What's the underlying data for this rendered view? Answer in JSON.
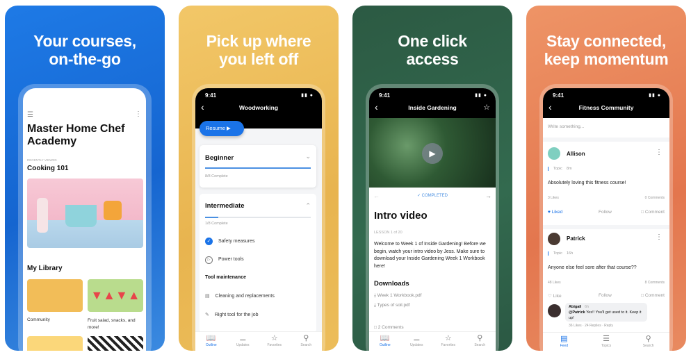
{
  "colors": {
    "blue_panel": "#1b72de",
    "yellow_panel": "#efbf5c",
    "green_panel": "#2f5f46",
    "orange_panel": "#e8845c",
    "accent": "#1a73e8"
  },
  "panels": [
    {
      "headline": [
        "Your courses,",
        "on-the-go"
      ],
      "screen": {
        "menu_icon": "hamburger-icon",
        "more_icon": "kebab-icon",
        "title": "Master Home Chef Academy",
        "recently_viewed_label": "RECENTLY VIEWED",
        "recent_course": "Cooking 101",
        "library_heading": "My Library",
        "library_items": [
          "Community",
          "Fruit salad, snacks, and more!"
        ]
      }
    },
    {
      "headline": [
        "Pick up where",
        "you left off"
      ],
      "screen": {
        "time": "9:41",
        "title": "Woodworking",
        "resume_label": "Resume",
        "sections": [
          {
            "title": "Beginner",
            "progress_text": "8/8 Complete",
            "progress": 1.0,
            "expanded": false
          },
          {
            "title": "Intermediate",
            "progress_text": "1/8 Complete",
            "progress": 0.125,
            "expanded": true
          }
        ],
        "lessons": [
          {
            "label": "Safety measures",
            "icon": "check-circle-icon",
            "done": true
          },
          {
            "label": "Power tools",
            "icon": "play-circle-icon"
          }
        ],
        "subheading": "Tool maintenance",
        "sublessons": [
          {
            "label": "Cleaning and replacements",
            "icon": "document-icon"
          },
          {
            "label": "Right tool for the job",
            "icon": "edit-document-icon"
          }
        ],
        "tabs": [
          "Outline",
          "Updates",
          "Favorites",
          "Search"
        ]
      }
    },
    {
      "headline": [
        "One click",
        "access"
      ],
      "screen": {
        "time": "9:41",
        "title": "Inside Gardening",
        "status": "COMPLETED",
        "lesson_title": "Intro video",
        "lesson_meta": "LESSON 1 of 20",
        "body": "Welcome to Week 1 of Inside Gardening! Before we begin, watch your intro video by Jess. Make sure to download your Inside Gardening Week 1 Workbook here!",
        "downloads_heading": "Downloads",
        "downloads": [
          "Week 1 Workbook.pdf",
          "Types of soil.pdf"
        ],
        "comments": "2 Comments",
        "tabs": [
          "Outline",
          "Updates",
          "Favorites",
          "Search"
        ]
      }
    },
    {
      "headline": [
        "Stay connected,",
        "keep momentum"
      ],
      "screen": {
        "time": "9:41",
        "title": "Fitness Community",
        "compose_placeholder": "Write something...",
        "posts": [
          {
            "author": "Allison",
            "tag": "Topic",
            "age": "8m",
            "text": "Absolutely loving this fitness course!",
            "likes": "3 Likes",
            "comments": "0 Comments",
            "like_label": "Liked",
            "liked": true,
            "follow": "Follow",
            "comment": "Comment"
          },
          {
            "author": "Patrick",
            "tag": "Topic",
            "age": "16h",
            "text": "Anyone else feel sore after that course??",
            "likes": "48 Likes",
            "comments": "8 Comments",
            "like_label": "Like",
            "liked": false,
            "follow": "Follow",
            "comment": "Comment"
          }
        ],
        "reply": {
          "author": "Abigail",
          "age": "6h",
          "mention": "@Patrick",
          "text": " Yes!! You'll get used to it. Keep it up!",
          "meta": "36 Likes · 24 Replies · Reply"
        },
        "tabs": [
          "Feed",
          "Topics",
          "Search"
        ]
      }
    }
  ]
}
